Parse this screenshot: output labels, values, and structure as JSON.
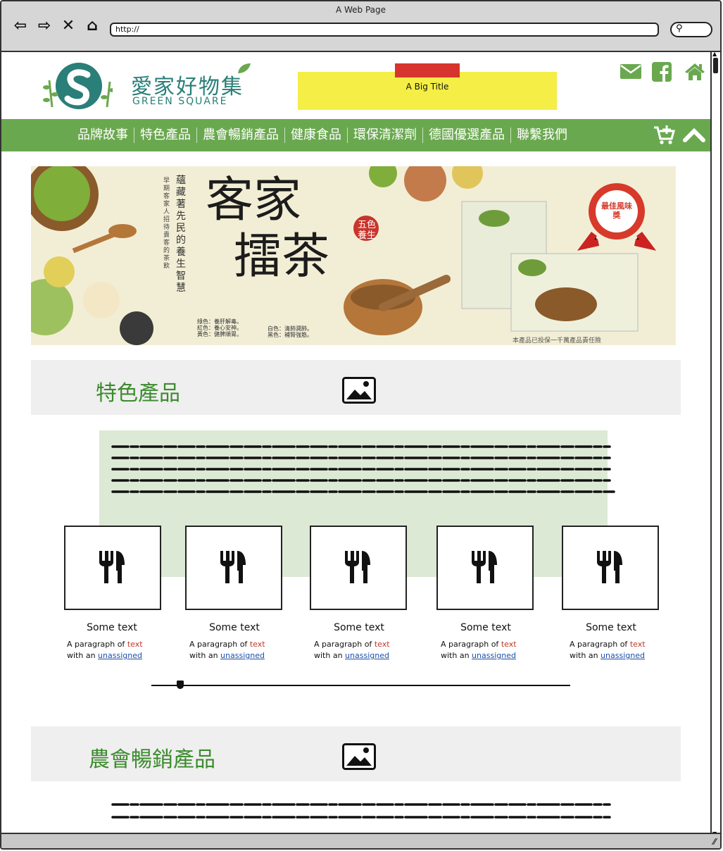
{
  "window": {
    "title": "A Web Page",
    "url": "http://"
  },
  "logo": {
    "chinese": "愛家好物集",
    "english": "GREEN SQUARE"
  },
  "big_title": "A Big Title",
  "top_icons": [
    "mail-icon",
    "facebook-icon",
    "home-icon"
  ],
  "nav": {
    "items": [
      "品牌故事",
      "特色產品",
      "農會暢銷產品",
      "健康食品",
      "環保清潔劑",
      "德國優選產品",
      "聯繫我們"
    ],
    "cart_icon": "cart-add-icon",
    "up_icon": "chevron-up-icon"
  },
  "banner": {
    "title_line1": "客家",
    "title_line2": "擂茶",
    "seal": "五色養生",
    "vertical_slogan": "蘊藏著先民的養生智慧",
    "vertical_sub": "早期客家人招待貴客的茶飲",
    "badge": "最佳風味獎",
    "legend_left": [
      "綠色：養肝解毒。",
      "紅色：養心安神。",
      "黃色：健脾順胃。"
    ],
    "legend_right": [
      "白色：清肺潤肺。",
      "黑色：補腎強筋。"
    ],
    "footer": "本產品已投保一千萬產品責任險"
  },
  "sections": [
    {
      "title": "特色產品"
    },
    {
      "title": "農會暢銷產品"
    }
  ],
  "cards": [
    {
      "title": "Some text",
      "para_a": "A paragraph of ",
      "para_b": "text",
      "para_c": "with an ",
      "para_d": "unassigned"
    },
    {
      "title": "Some text",
      "para_a": "A paragraph of ",
      "para_b": "text",
      "para_c": "with an ",
      "para_d": "unassigned"
    },
    {
      "title": "Some text",
      "para_a": "A paragraph of ",
      "para_b": "text",
      "para_c": "with an ",
      "para_d": "unassigned"
    },
    {
      "title": "Some text",
      "para_a": "A paragraph of ",
      "para_b": "text",
      "para_c": "with an ",
      "para_d": "unassigned"
    },
    {
      "title": "Some text",
      "para_a": "A paragraph of ",
      "para_b": "text",
      "para_c": "with an ",
      "para_d": "unassigned"
    }
  ],
  "slider": {
    "value": 0.06
  },
  "colors": {
    "brand_green": "#6aa84f",
    "logo_teal": "#2a7f78",
    "heading_green": "#3c8b2e",
    "sticky_yellow": "#f4ee46",
    "tape_red": "#d8342f",
    "panel_green": "#dce9d5"
  }
}
